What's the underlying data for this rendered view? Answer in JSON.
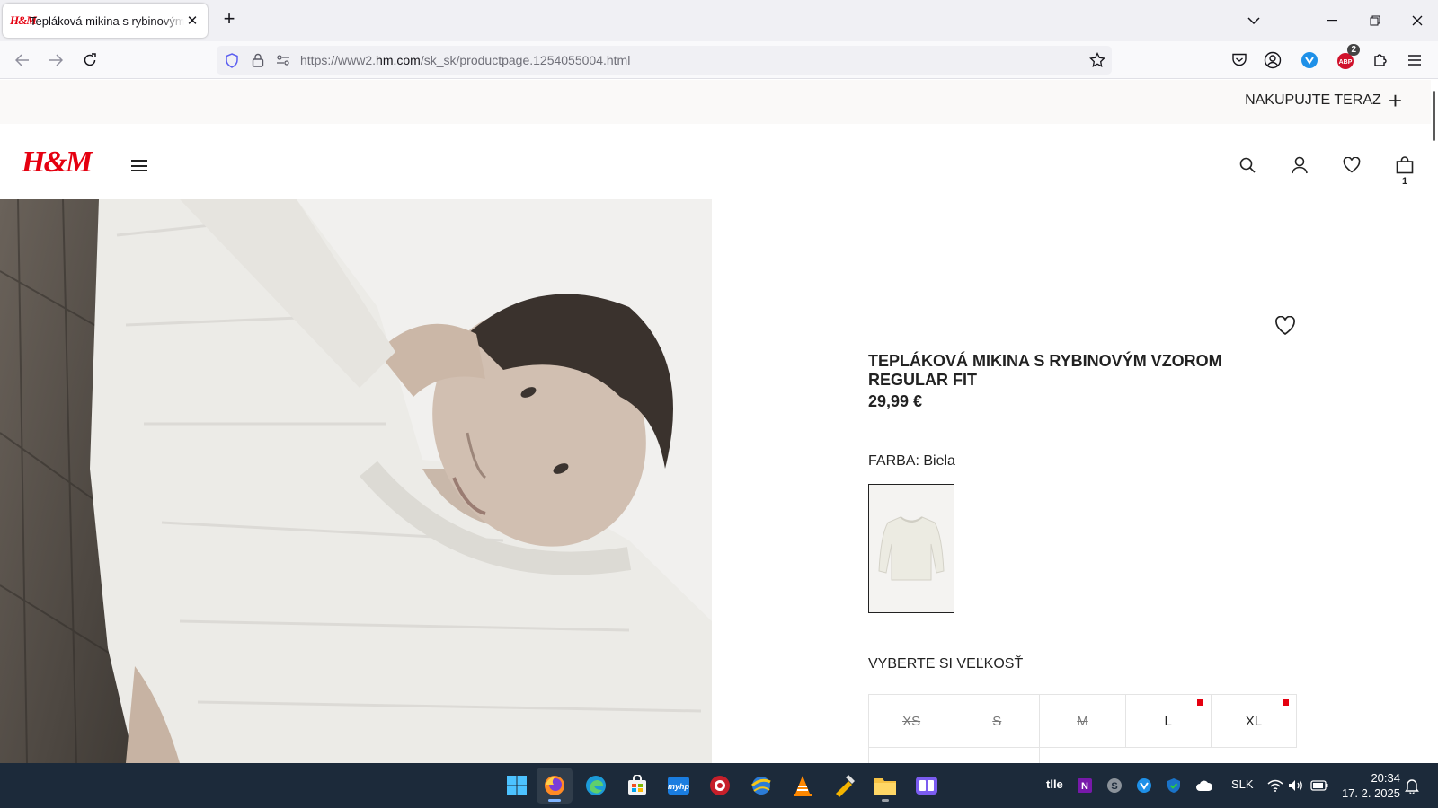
{
  "browser": {
    "tab_title": "Tepláková mikina s rybinovým vzorom",
    "tab_favicon": "H&M",
    "url_prefix": "https://www2.",
    "url_domain": "hm.com",
    "url_path": "/sk_sk/productpage.1254055004.html",
    "extension_badge": "2",
    "icons": [
      "back-arrow-icon",
      "forward-arrow-icon",
      "reload-icon",
      "shield-icon",
      "lock-icon",
      "permissions-icon",
      "star-icon",
      "pocket-icon",
      "account-icon",
      "extension-icon",
      "puzzle-icon",
      "menu-icon"
    ]
  },
  "promo": {
    "text": "NAKUPUJTE TERAZ"
  },
  "header": {
    "logo": "H&M",
    "bag_count": "1",
    "icons": [
      "search-icon",
      "user-icon",
      "heart-icon",
      "bag-icon"
    ]
  },
  "product": {
    "title": "TEPLÁKOVÁ MIKINA S RYBINOVÝM VZOROM REGULAR FIT",
    "price": "29,99 €",
    "color_label": "FARBA: Biela",
    "size_label": "VYBERTE SI VEĽKOSŤ",
    "sizes": [
      {
        "label": "XS",
        "available": false,
        "low_stock": false
      },
      {
        "label": "S",
        "available": false,
        "low_stock": false
      },
      {
        "label": "M",
        "available": false,
        "low_stock": false
      },
      {
        "label": "L",
        "available": true,
        "low_stock": true
      },
      {
        "label": "XL",
        "available": true,
        "low_stock": true
      }
    ]
  },
  "taskbar": {
    "apps": [
      "windows-start-icon",
      "firefox-icon",
      "edge-icon",
      "store-icon",
      "myhp-icon",
      "app-red-icon",
      "app-globe-icon",
      "vlc-icon",
      "app-tool-icon",
      "file-explorer-icon",
      "app-purple-icon"
    ],
    "tray_text": "tlle",
    "language": "SLK",
    "time": "20:34",
    "date": "17. 2. 2025"
  },
  "colors": {
    "brand_red": "#e50010",
    "taskbar_bg": "#1c2a3a",
    "chrome_bg": "#f0f0f4"
  }
}
